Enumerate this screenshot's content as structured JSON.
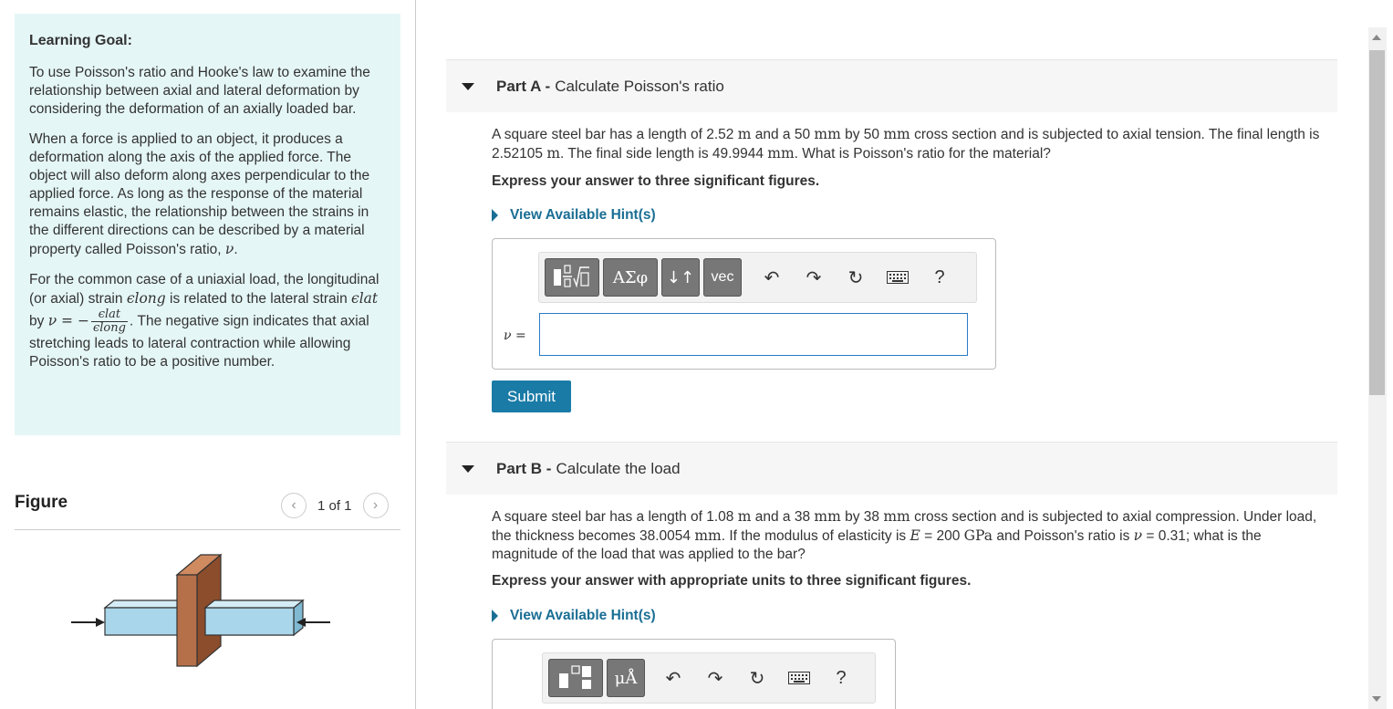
{
  "goal": {
    "title": "Learning Goal:",
    "p1": "To use Poisson's ratio and Hooke's law to examine the relationship between axial and lateral deformation by considering the deformation of an axially loaded bar.",
    "p2": "When a force is applied to an object, it produces a deformation along the axis of the applied force. The object will also deform along axes perpendicular to the applied force. As long as the response of the material remains elastic, the relationship between the strains in the different directions can be described by a material property called Poisson's ratio,",
    "p2_symbol": "ν",
    "p3_a": "For the common case of a uniaxial load, the longitudinal (or axial) strain",
    "p3_elong": "ϵlong",
    "p3_b": "is related to the lateral strain",
    "p3_elat": "ϵlat",
    "p3_by": "by",
    "p3_formula_lhs": "ν = −",
    "p3_frac_num": "ϵlat",
    "p3_frac_den": "ϵlong",
    "p3_c": ". The negative sign indicates that axial stretching leads to lateral contraction while allowing Poisson's ratio to be a positive number."
  },
  "figure": {
    "title": "Figure",
    "pager": "1 of 1"
  },
  "partA": {
    "label": "Part A -",
    "title": "Calculate Poisson's ratio",
    "t1": "A square steel bar has a length of 2.52",
    "u_m": "m",
    "t2": "and a 50",
    "u_mm": "mm",
    "t3": "by 50",
    "t4": "cross section and is subjected to axial tension. The final length is 2.52105",
    "t5": ". The final side length is 49.9944",
    "t6": ". What is Poisson's ratio for the material?",
    "express": "Express your answer to three significant figures.",
    "hint": "View Available Hint(s)",
    "answer_label": "ν =",
    "submit": "Submit",
    "tb_greek": "ΑΣφ",
    "tb_arrows": "↓↑",
    "tb_vec": "vec",
    "tb_help": "?"
  },
  "partB": {
    "label": "Part B -",
    "title": "Calculate the load",
    "t1": "A square steel bar has a length of 1.08",
    "u_m": "m",
    "t2": "and a 38",
    "u_mm": "mm",
    "t3": "by 38",
    "t4": "cross section and is subjected to axial compression. Under load, the thickness becomes 38.0054",
    "t5": ". If the modulus of elasticity is",
    "sym_E": "E",
    "t6": "= 200",
    "u_gpa": "GPa",
    "t7": "and Poisson's ratio is",
    "sym_nu": "ν",
    "t8": "= 0.31; what is the magnitude of the load that was applied to the bar?",
    "express": "Express your answer with appropriate units to three significant figures.",
    "hint": "View Available Hint(s)",
    "tb_units": "μÅ",
    "tb_help": "?"
  },
  "colors": {
    "goal_bg": "#e5f6f6",
    "link": "#1a6e94",
    "submit_bg": "#1a7ba7",
    "bar_blue": "#a9d6ea",
    "plate_brown": "#b5704a"
  }
}
